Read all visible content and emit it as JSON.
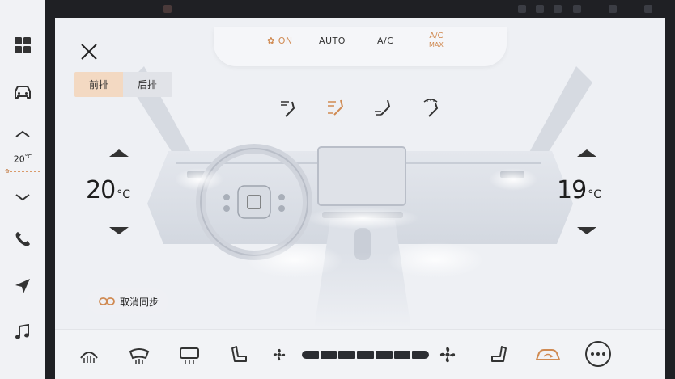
{
  "sidebar": {
    "items": [
      {
        "name": "apps-grid-icon"
      },
      {
        "name": "car-icon"
      },
      {
        "name": "temp-up-chevron-icon"
      },
      {
        "name": "temp-down-chevron-icon"
      },
      {
        "name": "phone-icon"
      },
      {
        "name": "navigation-icon"
      },
      {
        "name": "music-icon"
      }
    ],
    "temperature": "20",
    "temperature_unit": "°C"
  },
  "top_controls": {
    "power_label": "ON",
    "auto_label": "AUTO",
    "ac_label": "A/C",
    "ac_max_top": "A/C",
    "ac_max_bottom": "MAX"
  },
  "tabs": {
    "front": "前排",
    "rear": "后排",
    "active": "front"
  },
  "airflow_modes": [
    "airflow-face-icon",
    "airflow-face-feet-icon",
    "airflow-feet-icon",
    "airflow-defrost-feet-icon"
  ],
  "left_zone": {
    "temperature": "20",
    "unit": "°C"
  },
  "right_zone": {
    "temperature": "19",
    "unit": "°C"
  },
  "sync_button": {
    "label": "取消同步"
  },
  "fan": {
    "level": 7,
    "max": 7
  },
  "colors": {
    "accent": "#d08a52",
    "tab_active": "#f3d9c2",
    "panel_bg": "#eef0f4",
    "dark": "#1f2024"
  }
}
